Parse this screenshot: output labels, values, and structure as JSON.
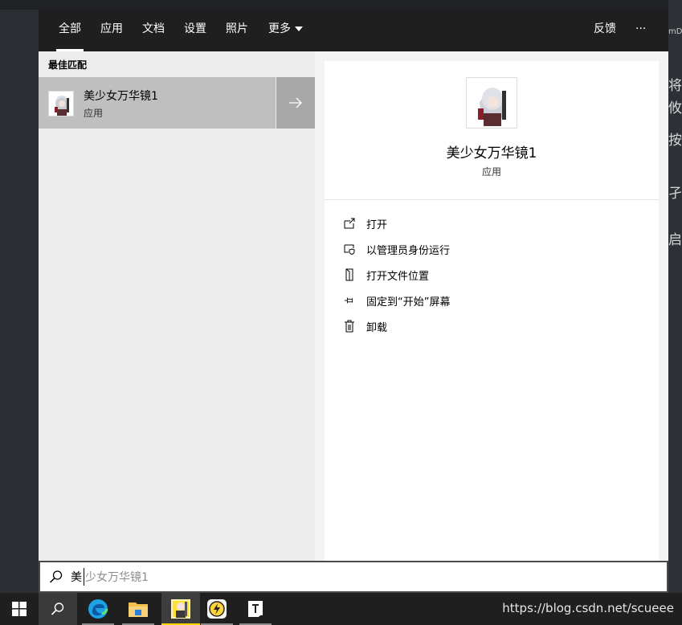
{
  "background": {
    "right_fragments": [
      "将等",
      "攸人",
      "按",
      "孑",
      "启"
    ],
    "right_small": "mD"
  },
  "nav": {
    "tabs": [
      {
        "label": "全部",
        "active": true
      },
      {
        "label": "应用"
      },
      {
        "label": "文档"
      },
      {
        "label": "设置"
      },
      {
        "label": "照片"
      },
      {
        "label": "更多"
      }
    ],
    "feedback": "反馈",
    "options": "···"
  },
  "best_match": {
    "title": "最佳匹配",
    "item": {
      "name": "美少女万华镜1",
      "type": "应用"
    },
    "arrow": "→"
  },
  "preview": {
    "name": "美少女万华镜1",
    "type": "应用",
    "actions": [
      {
        "label": "打开",
        "icon": "open-icon"
      },
      {
        "label": "以管理员身份运行",
        "icon": "run-as-admin-icon"
      },
      {
        "label": "打开文件位置",
        "icon": "file-location-icon"
      },
      {
        "label": "固定到“开始”屏幕",
        "icon": "pin-icon"
      },
      {
        "label": "卸载",
        "icon": "trash-icon"
      }
    ]
  },
  "search": {
    "typed": "美",
    "suggestion": "少女万华镜1"
  },
  "taskbar": {
    "watermark": "https://blog.csdn.net/scueee",
    "explorer_accent": "#f2c14e",
    "edge_accent": "#1fa1e5"
  }
}
